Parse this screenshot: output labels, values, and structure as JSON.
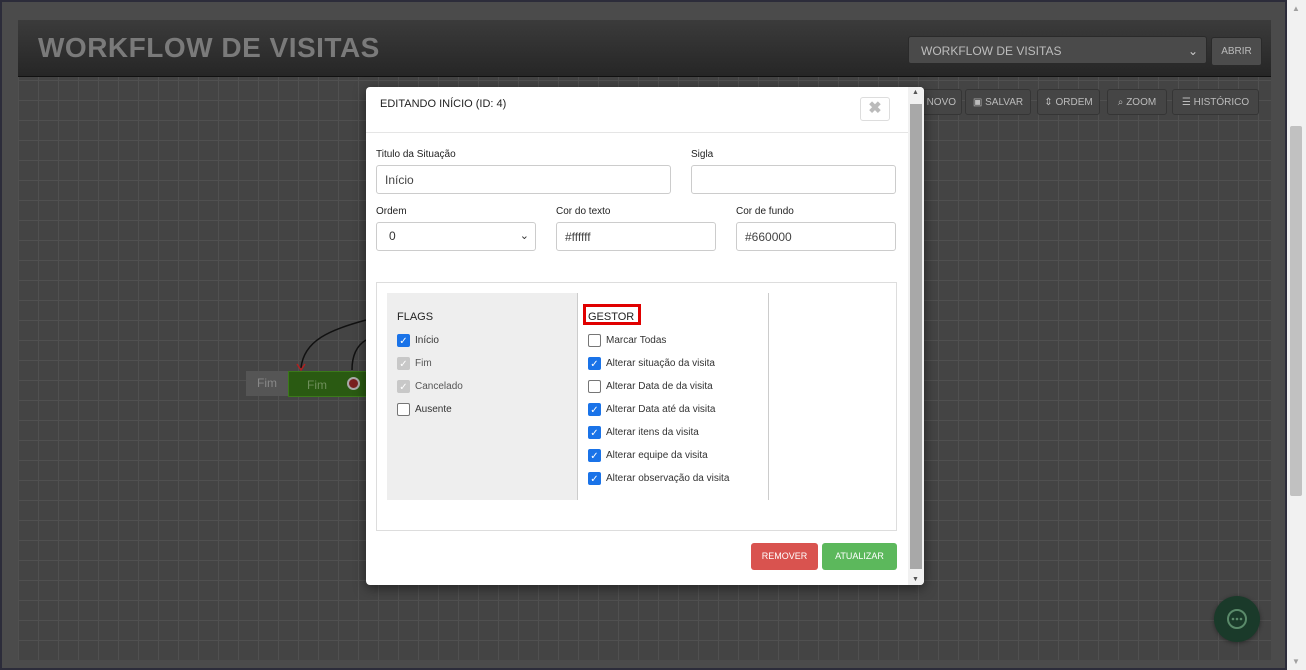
{
  "app": {
    "title": "WORKFLOW DE VISITAS",
    "workflow_select_value": "WORKFLOW DE VISITAS",
    "open_label": "ABRIR"
  },
  "toolbar": {
    "novo_label": "NOVO",
    "salvar_label": "SALVAR",
    "ordem_label": "ORDEM",
    "zoom_label": "ZOOM",
    "historico_label": "HISTÓRICO"
  },
  "canvas": {
    "node_fim_grey": "Fim",
    "node_fim_green": "Fim"
  },
  "modal": {
    "title": "EDITANDO INÍCIO (ID: 4)",
    "close_symbol": "✖",
    "fields": {
      "titulo_label": "Titulo da Situação",
      "titulo_value": "Início",
      "sigla_label": "Sigla",
      "sigla_value": "",
      "ordem_label": "Ordem",
      "ordem_value": "0",
      "cor_texto_label": "Cor do texto",
      "cor_texto_value": "#ffffff",
      "cor_fundo_label": "Cor de fundo",
      "cor_fundo_value": "#660000"
    },
    "flags": {
      "title": "FLAGS",
      "items": [
        {
          "label": "Início",
          "checked": true,
          "disabled": false
        },
        {
          "label": "Fim",
          "checked": true,
          "disabled": true
        },
        {
          "label": "Cancelado",
          "checked": true,
          "disabled": true
        },
        {
          "label": "Ausente",
          "checked": false,
          "disabled": false
        }
      ]
    },
    "gestor": {
      "title": "GESTOR",
      "items": [
        {
          "label": "Marcar Todas",
          "checked": false
        },
        {
          "label": "Alterar situação da visita",
          "checked": true
        },
        {
          "label": "Alterar Data de da visita",
          "checked": false
        },
        {
          "label": "Alterar Data até da visita",
          "checked": true
        },
        {
          "label": "Alterar itens da visita",
          "checked": true
        },
        {
          "label": "Alterar equipe da visita",
          "checked": true
        },
        {
          "label": "Alterar observação da visita",
          "checked": true
        }
      ]
    },
    "remove_label": "REMOVER",
    "update_label": "ATUALIZAR"
  },
  "colors": {
    "remove": "#d9534f",
    "update": "#5cb85c",
    "highlight": "#e00000",
    "checkbox": "#1a73e8"
  }
}
